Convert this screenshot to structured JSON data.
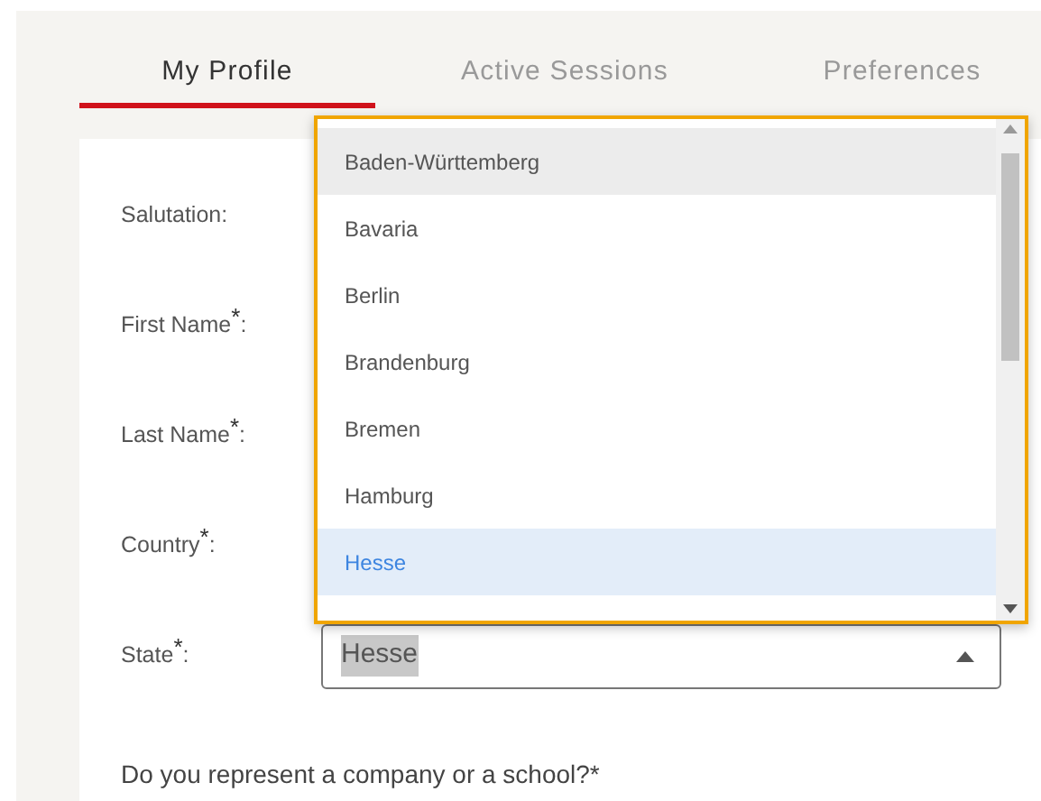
{
  "tabs": [
    {
      "label": "My Profile",
      "selected": true
    },
    {
      "label": "Active Sessions",
      "selected": false
    },
    {
      "label": "Preferences",
      "selected": false
    }
  ],
  "form": {
    "fields": [
      {
        "label": "Salutation:",
        "kind": "plain"
      },
      {
        "label": "First Name$^{*}$:",
        "kind": "plain"
      },
      {
        "label": "Last Name$^{*}$:",
        "kind": "plain"
      },
      {
        "label": "Country$^{*}$:",
        "kind": "plain"
      },
      {
        "label": "State$^{*}$:",
        "kind": "select",
        "value": "Hesse",
        "expanded": true
      }
    ],
    "dropdown": {
      "options": [
        {
          "label": "Baden-Württemberg",
          "selected": false,
          "hovered": true
        },
        {
          "label": "Bavaria",
          "selected": false,
          "hovered": false
        },
        {
          "label": "Berlin",
          "selected": false,
          "hovered": false
        },
        {
          "label": "Brandenburg",
          "selected": false,
          "hovered": false
        },
        {
          "label": "Bremen",
          "selected": false,
          "hovered": false
        },
        {
          "label": "Hamburg",
          "selected": false,
          "hovered": false
        },
        {
          "label": "Hesse",
          "selected": true,
          "hovered": false
        }
      ]
    },
    "question": {
      "label": "Do you represent a company or a school?*"
    }
  }
}
